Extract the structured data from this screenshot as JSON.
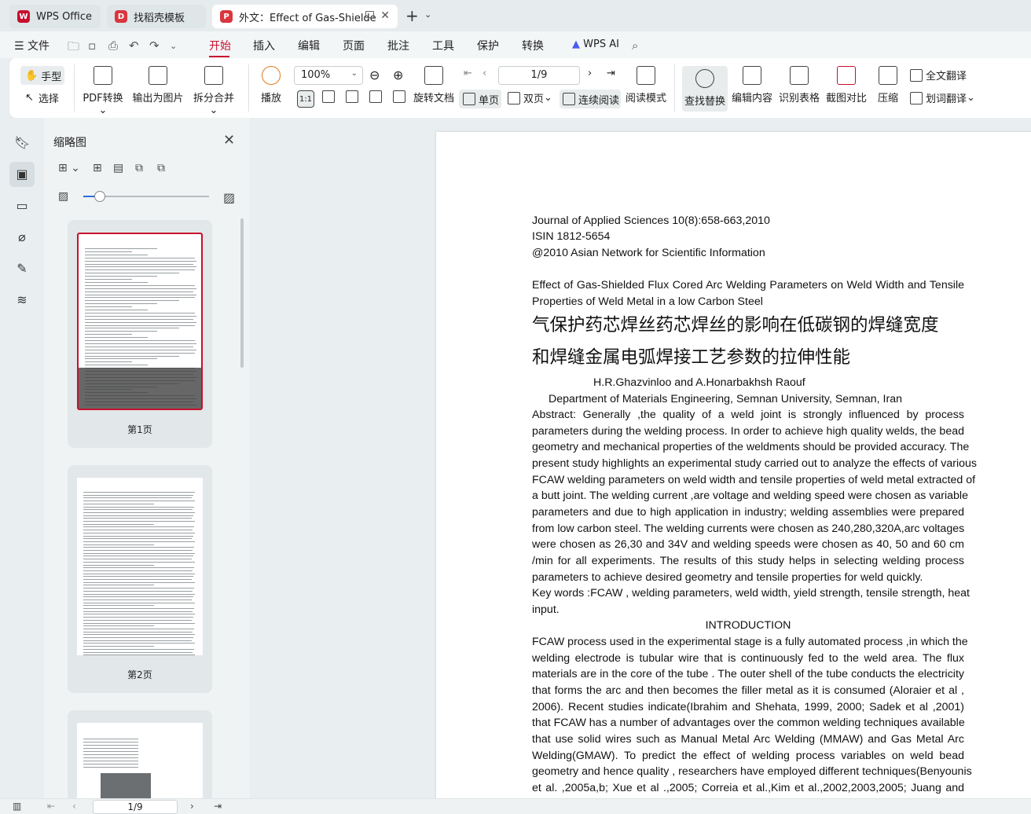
{
  "tabs": [
    {
      "label": "WPS Office",
      "color": "#c8102e"
    },
    {
      "label": "找稻壳模板",
      "color": "#d9363e"
    },
    {
      "label": "外文：Effect of Gas-Shielde",
      "color": "#d9363e"
    }
  ],
  "menu": {
    "file": "文件",
    "items": [
      "开始",
      "插入",
      "编辑",
      "页面",
      "批注",
      "工具",
      "保护",
      "转换"
    ],
    "active": "开始",
    "wps_ai": "WPS AI"
  },
  "ribbon": {
    "hand": "手型",
    "select": "选择",
    "pdf_convert": "PDF转换",
    "export_image": "输出为图片",
    "split_merge": "拆分合并",
    "play": "播放",
    "zoom": "100%",
    "rotate": "旋转文档",
    "single_page": "单页",
    "double_page": "双页",
    "continuous": "连续阅读",
    "page_indicator": "1/9",
    "reading_mode": "阅读模式",
    "find_replace": "查找替换",
    "edit_content": "编辑内容",
    "recognize_table": "识别表格",
    "screenshot_compare": "截图对比",
    "compress": "压缩",
    "full_translate": "全文翻译",
    "word_translate": "划词翻译"
  },
  "thumbnails": {
    "title": "缩略图",
    "pages": [
      "第1页",
      "第2页"
    ]
  },
  "document": {
    "header_lines": [
      "Journal of Applied Sciences 10(8):658-663,2010",
      "ISIN 1812-5654",
      "@2010 Asian Network for Scientific Information"
    ],
    "title_en": [
      "Effect of Gas-Shielded Flux Cored Arc Welding Parameters on Weld Width and Tensile",
      "Properties of Weld Metal in a low Carbon Steel"
    ],
    "title_cn": [
      "气保护药芯焊丝药芯焊丝的影响在低碳钢的焊缝宽度",
      "和焊缝金属电弧焊接工艺参数的拉伸性能"
    ],
    "authors": "H.R.Ghazvinloo and A.Honarbakhsh Raouf",
    "affiliation": "Department of Materials Engineering, Semnan   University, Semnan, Iran",
    "abstract_lines": [
      "Abstract:  Generally ,the quality of a weld joint is strongly influenced by process",
      "parameters during the welding process. In order to achieve high quality welds, the bead",
      "geometry and mechanical properties of the weldments should be provided accuracy. The",
      "present study highlights an experimental study carried out to analyze the effects of various",
      "FCAW welding parameters on weld width and tensile properties of weld metal extracted of",
      "a butt joint. The welding current ,are voltage and welding speed were chosen as variable",
      "parameters and due to high application in industry; welding assemblies were prepared",
      "from low carbon steel. The welding currents were chosen as 240,280,320A,arc voltages",
      "were chosen as 26,30 and 34V and welding speeds were chosen as 40, 50 and 60 cm",
      "/min for all experiments. The results of this study helps in selecting welding process",
      "parameters to achieve desired geometry and tensile properties for weld quickly."
    ],
    "keywords_lines": [
      "Key words :FCAW , welding parameters, weld width, yield strength, tensile strength, heat",
      "input."
    ],
    "section_heading": "INTRODUCTION",
    "intro_lines": [
      "FCAW process used in the experimental stage is a fully automated process ,in which the",
      "welding electrode is tubular wire that is continuously fed to the weld area. The flux",
      "materials are in the core of the tube . The outer shell of the tube conducts the electricity",
      "that forms the arc and then becomes the filler metal as it is consumed (Aloraier   et   al ,",
      "2006). Recent studies indicate(Ibrahim and Shehata, 1999, 2000; Sadek   et al ,2001)",
      "that FCAW has a number of advantages over the common welding techniques available",
      "that use solid wires such as Manual Metal Arc Welding (MMAW) and Gas Metal Arc",
      "Welding(GMAW). To predict the effect of welding process variables on weld bead",
      "geometry and hence quality , researchers have employed different techniques(Benyounis",
      "et al. ,2005a,b; Xue et al .,2005; Correia et al.,Kim et al.,2002,2003,2005; Juang and"
    ]
  },
  "status": {
    "page_indicator": "1/9"
  }
}
